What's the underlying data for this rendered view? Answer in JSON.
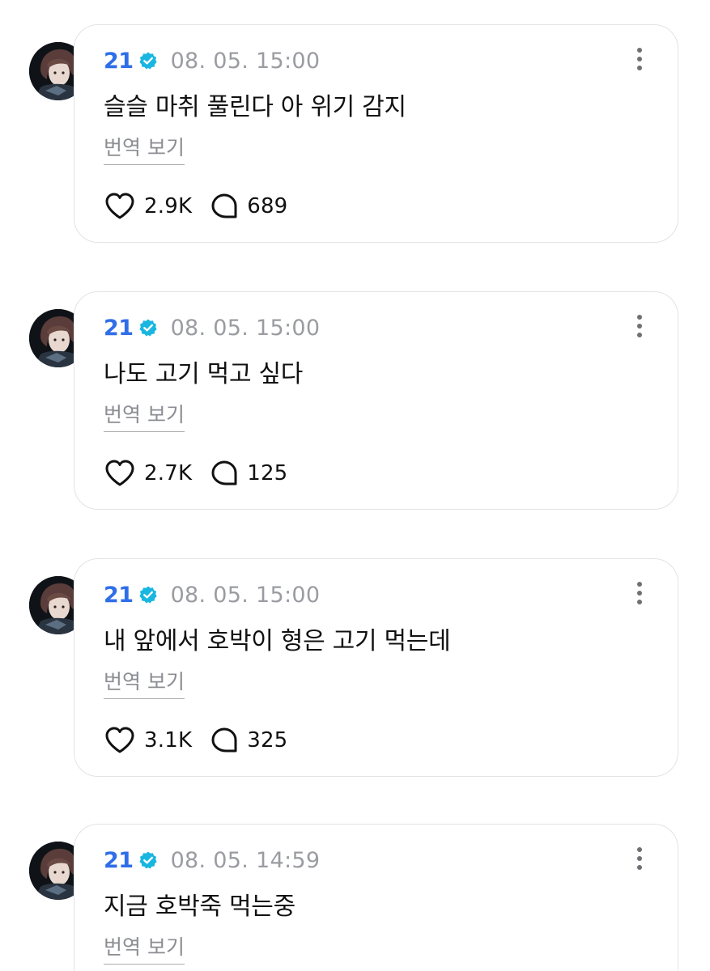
{
  "posts": [
    {
      "author": "21",
      "time": "08. 05. 15:00",
      "text": "슬슬 마취 풀린다 아 위기 감지",
      "translate_label": "번역 보기",
      "likes": "2.9K",
      "comments": "689"
    },
    {
      "author": "21",
      "time": "08. 05. 15:00",
      "text": "나도 고기 먹고 싶다",
      "translate_label": "번역 보기",
      "likes": "2.7K",
      "comments": "125"
    },
    {
      "author": "21",
      "time": "08. 05. 15:00",
      "text": "내 앞에서 호박이 형은 고기 먹는데",
      "translate_label": "번역 보기",
      "likes": "3.1K",
      "comments": "325"
    },
    {
      "author": "21",
      "time": "08. 05. 14:59",
      "text": "지금 호박죽 먹는중",
      "translate_label": "번역 보기"
    }
  ],
  "colors": {
    "author": "#2f6ee8",
    "verified_badge": "#19b6e0",
    "time": "#9a9ca1",
    "border": "#e3e3e6"
  },
  "icons": {
    "verified": "verified-badge-icon",
    "more": "more-vertical-icon",
    "like": "heart-icon",
    "comment": "comment-bubble-icon"
  }
}
